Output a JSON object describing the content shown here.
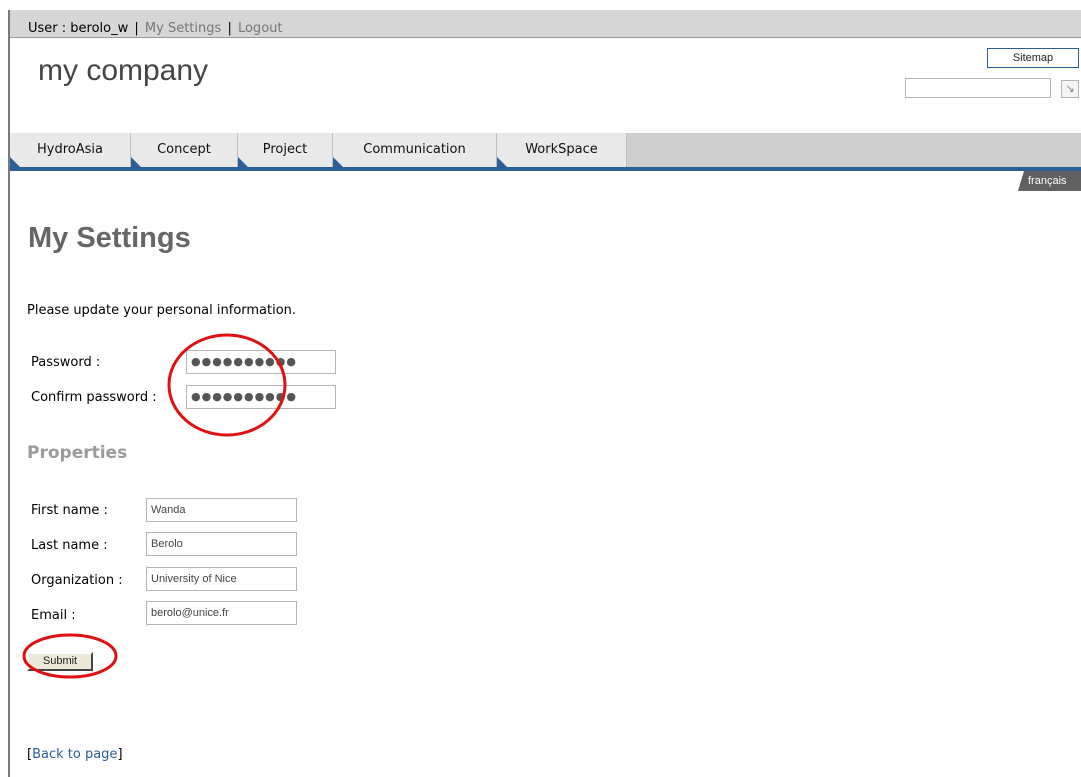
{
  "header": {
    "user_prefix": "User : ",
    "username": "berolo_w",
    "separator": "|",
    "my_settings_link": "My Settings",
    "logout_link": "Logout",
    "company_name": "my company",
    "sitemap_label": "Sitemap",
    "search_value": "",
    "search_go_icon": "arrow-go-icon",
    "search_go_glyph": "↘"
  },
  "nav": {
    "tabs": [
      {
        "label": "HydroAsia"
      },
      {
        "label": "Concept"
      },
      {
        "label": "Project"
      },
      {
        "label": "Communication"
      },
      {
        "label": "WorkSpace"
      }
    ],
    "language": "français"
  },
  "main": {
    "title": "My Settings",
    "intro": "Please update your personal information.",
    "password_label": "Password :",
    "password_value": "●●●●●●●●●●",
    "confirm_label": "Confirm password :",
    "confirm_value": "●●●●●●●●●●",
    "properties_title": "Properties",
    "fields": [
      {
        "label": "First name :",
        "value": "Wanda"
      },
      {
        "label": "Last name :",
        "value": "Berolo"
      },
      {
        "label": "Organization :",
        "value": "University of Nice"
      },
      {
        "label": "Email :",
        "value": "berolo@unice.fr"
      }
    ],
    "submit_label": "Submit",
    "back_open": "[",
    "back_link": "Back to page",
    "back_close": "]"
  },
  "colors": {
    "nav_accent": "#2b5f97",
    "annotation_red": "#e01010",
    "title_gray": "#666666"
  }
}
